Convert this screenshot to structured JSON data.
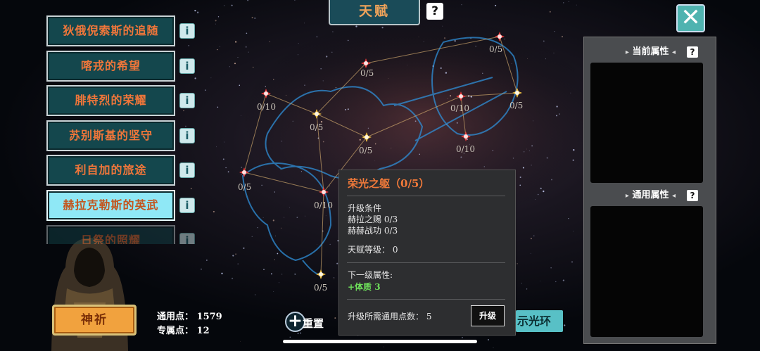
{
  "header": {
    "title": "天赋",
    "help_icon": "question-icon"
  },
  "talents": [
    {
      "label": "狄俄倪索斯的追随",
      "active": false
    },
    {
      "label": "喀戎的希望",
      "active": false
    },
    {
      "label": "腓特烈的荣耀",
      "active": false
    },
    {
      "label": "苏别斯基的坚守",
      "active": false
    },
    {
      "label": "利自加的旅途",
      "active": false
    },
    {
      "label": "赫拉克勒斯的英武",
      "active": true
    },
    {
      "label": "日祭的照耀",
      "active": false
    }
  ],
  "info_label": "i",
  "constellation": {
    "nodes": [
      {
        "label": "0/5",
        "color": "#e83a3a"
      },
      {
        "label": "0/5",
        "color": "#e83a3a"
      },
      {
        "label": "0/10",
        "color": "#e83a3a"
      },
      {
        "label": "0/5",
        "color": "#f0c040"
      },
      {
        "label": "0/10",
        "color": "#e83a3a"
      },
      {
        "label": "0/5",
        "color": "#f0c040"
      },
      {
        "label": "0/5",
        "color": "#f0c040"
      },
      {
        "label": "0/10",
        "color": "#e83a3a"
      },
      {
        "label": "0/5",
        "color": "#e83a3a"
      },
      {
        "label": "0/10",
        "color": "#e83a3a"
      },
      {
        "label": "0/5",
        "color": "#f0c040"
      }
    ]
  },
  "tooltip": {
    "title": "荣光之躯（0/5）",
    "req_header": "升级条件",
    "req1": "赫拉之赐  0/3",
    "req2": "赫赫战功  0/3",
    "level": "天赋等级：  0",
    "next_header": "下一级属性:",
    "next_value": "+体质  3",
    "cost": "升级所需通用点数：  5",
    "upgrade_label": "升级"
  },
  "right_panel": {
    "current_header": "当前属性",
    "general_header": "通用属性"
  },
  "bottom": {
    "pray_label": "神祈",
    "general_points": "通用点：  1579",
    "special_points": "专属点：  12",
    "reset_label": "重置",
    "aura_label": "示光环"
  },
  "colors": {
    "accent_orange": "#f0763a",
    "teal": "#14474d",
    "active_teal": "#8fe8f6",
    "green": "#6ee05a"
  }
}
